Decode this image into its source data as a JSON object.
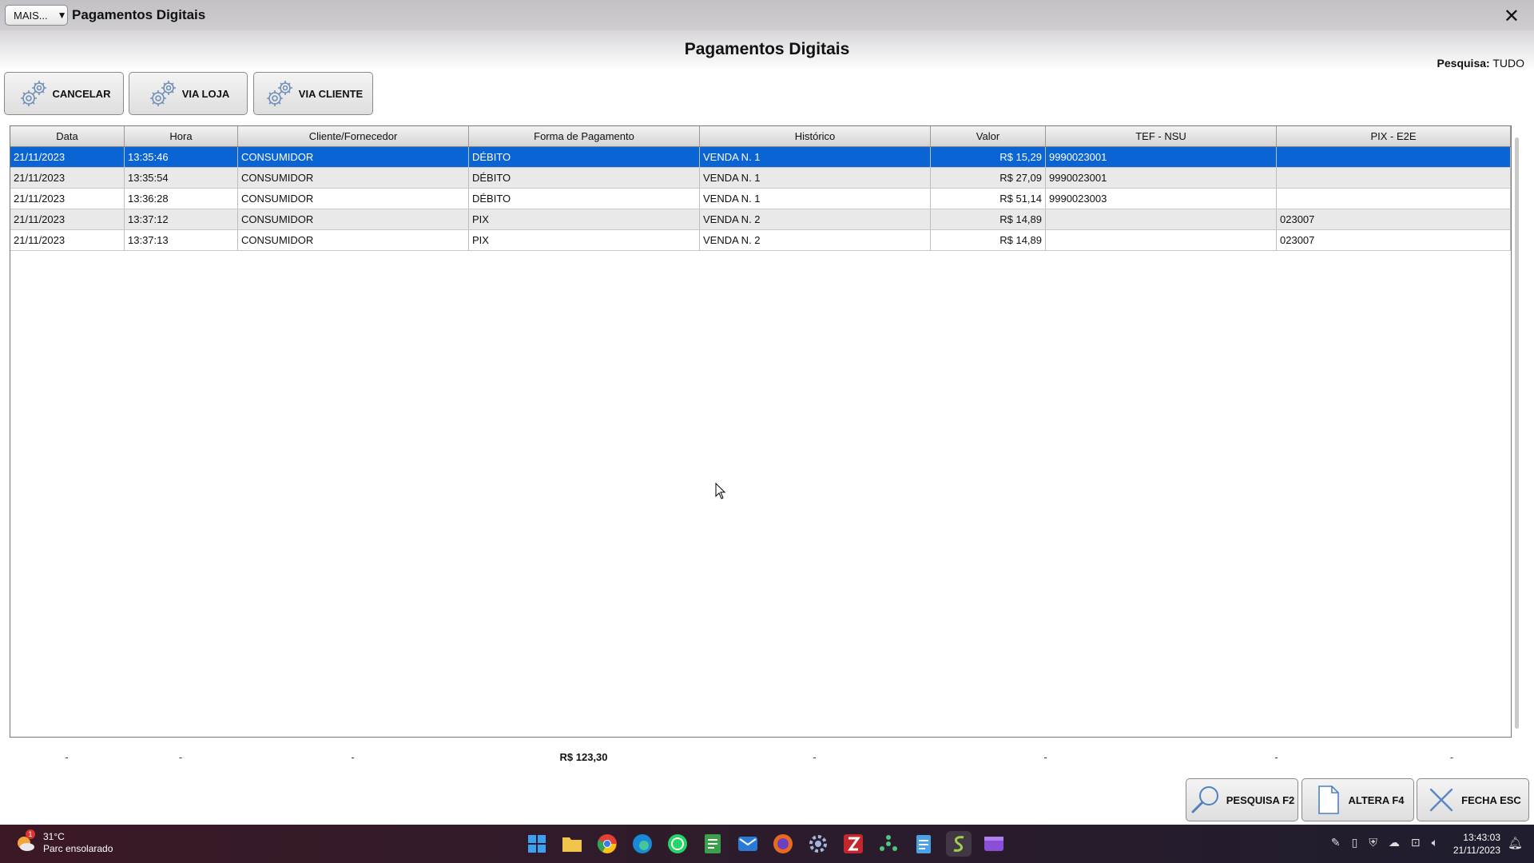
{
  "window": {
    "mais_label": "MAIS...",
    "title": "Pagamentos Digitais",
    "close_glyph": "✕"
  },
  "header": {
    "title": "Pagamentos Digitais",
    "search_label": "Pesquisa:",
    "search_value": "TUDO"
  },
  "toolbar": {
    "cancel_label": "CANCELAR",
    "store_copy_label": "VIA LOJA",
    "client_copy_label": "VIA CLIENTE",
    "icon": "gear-icon"
  },
  "table": {
    "columns": [
      "Data",
      "Hora",
      "Cliente/Fornecedor",
      "Forma de Pagamento",
      "Histórico",
      "Valor",
      "TEF - NSU",
      "PIX - E2E"
    ],
    "rows": [
      [
        "21/11/2023",
        "13:35:46",
        "CONSUMIDOR",
        "DÉBITO",
        "VENDA N. 1",
        "R$ 15,29",
        "9990023001",
        ""
      ],
      [
        "21/11/2023",
        "13:35:54",
        "CONSUMIDOR",
        "DÉBITO",
        "VENDA N. 1",
        "R$ 27,09",
        "9990023001",
        ""
      ],
      [
        "21/11/2023",
        "13:36:28",
        "CONSUMIDOR",
        "DÉBITO",
        "VENDA N. 1",
        "R$ 51,14",
        "9990023003",
        ""
      ],
      [
        "21/11/2023",
        "13:37:12",
        "CONSUMIDOR",
        "PIX",
        "VENDA N. 2",
        "R$ 14,89",
        "",
        "023007"
      ],
      [
        "21/11/2023",
        "13:37:13",
        "CONSUMIDOR",
        "PIX",
        "VENDA N. 2",
        "R$ 14,89",
        "",
        "023007"
      ]
    ],
    "selected_row": 0,
    "totals": [
      "-",
      "-",
      "-",
      "R$ 123,30",
      "-",
      "-",
      "-",
      "-"
    ]
  },
  "actions": {
    "search_label": "PESQUISA F2",
    "edit_label": "ALTERA F4",
    "close_label": "FECHA ESC"
  },
  "taskbar": {
    "weather_temp": "31°C",
    "weather_desc": "Parc ensolarado",
    "weather_badge": "1",
    "time": "13:43:03",
    "date": "21/11/2023"
  },
  "colors": {
    "selection": "#0a64d4",
    "titlebar": "#c7c5c9"
  }
}
